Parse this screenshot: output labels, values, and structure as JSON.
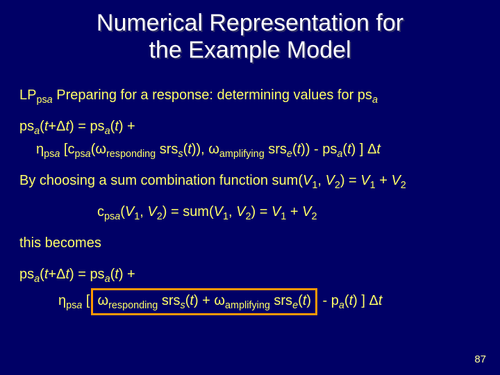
{
  "title_line1": "Numerical Representation for",
  "title_line2": "the Example Model",
  "lp_prefix": "LP",
  "lp_sub": "ps",
  "lp_sub_ital": "a",
  "lp_rest": " Preparing for a response: determining values for ps",
  "lp_tail_ital": "a",
  "eq1_lhs_ps": "ps",
  "eq1_lhs_a": "a",
  "eq1_lhs_paren": "(",
  "eq1_lhs_t": "t",
  "eq1_lhs_plus_dt": "+Δ",
  "eq1_lhs_t2": "t",
  "eq1_lhs_close_eq": ")  = ps",
  "eq1_rhs_a": "a",
  "eq1_rhs_paren": "(",
  "eq1_rhs_t": "t",
  "eq1_rhs_close_plus": ") +",
  "eq1b_eta": "η",
  "eq1b_eta_sub": "ps",
  "eq1b_eta_sub_a": "a",
  "eq1b_open": " [c",
  "eq1b_c_sub": "ps",
  "eq1b_c_sub_a": "a",
  "eq1b_w1": "(ω",
  "eq1b_w1_sub": "responding",
  "eq1b_srs_s": " srs",
  "eq1b_srs_s_sub": "s",
  "eq1b_srs_s_paren": "(",
  "eq1b_srs_s_t": "t",
  "eq1b_srs_s_close": ")), ω",
  "eq1b_w2_sub": "amplifying",
  "eq1b_srs_e": " srs",
  "eq1b_srs_e_sub": "e",
  "eq1b_srs_e_paren": "(",
  "eq1b_srs_e_t": "t",
  "eq1b_srs_e_close": ")) - ps",
  "eq1b_ps_a": "a",
  "eq1b_ps_paren": "(",
  "eq1b_ps_t": "t",
  "eq1b_tail": ") ] Δ",
  "eq1b_tail_t": "t",
  "sum_intro_a": "By choosing a sum combination function sum(",
  "sum_intro_v1": "V",
  "sum_intro_1": "1",
  "sum_intro_c": ", ",
  "sum_intro_v2": "V",
  "sum_intro_2": "2",
  "sum_intro_b": ") = ",
  "sum_intro_v1b": "V",
  "sum_intro_1b": "1",
  "sum_intro_p": " + ",
  "sum_intro_v2b": "V",
  "sum_intro_2b": "2",
  "eq2_c": "c",
  "eq2_c_sub": "ps",
  "eq2_c_sub_a": "a",
  "eq2_open": "(",
  "eq2_v1": "V",
  "eq2_1": "1",
  "eq2_c1": ", ",
  "eq2_v2": "V",
  "eq2_2": "2",
  "eq2_mid": ")  =  sum(",
  "eq2_v1b": "V",
  "eq2_1b": "1",
  "eq2_c2": ", ",
  "eq2_v2b": "V",
  "eq2_2b": "2",
  "eq2_eq2": ") = ",
  "eq2_v1c": "V",
  "eq2_1c": "1",
  "eq2_p2": " + ",
  "eq2_v2c": "V",
  "eq2_2c": "2",
  "becomes": "this becomes",
  "eq3_lhs_ps": "ps",
  "eq3_lhs_a": "a",
  "eq3_lhs_paren": "(",
  "eq3_lhs_t": "t",
  "eq3_lhs_plus_dt": "+Δ",
  "eq3_lhs_t2": "t",
  "eq3_lhs_close_eq": ")  = ps",
  "eq3_rhs_a": "a",
  "eq3_rhs_paren": "(",
  "eq3_rhs_t": "t",
  "eq3_rhs_close_plus": ") +",
  "eq3b_eta": "η",
  "eq3b_eta_sub": "ps",
  "eq3b_eta_sub_a": "a",
  "eq3b_outer_open": " [",
  "eq3b_w1": "ω",
  "eq3b_w1_sub": "responding",
  "eq3b_srs_s": " srs",
  "eq3b_srs_s_sub": "s",
  "eq3b_srs_s_paren": "(",
  "eq3b_srs_s_t": "t",
  "eq3b_srs_s_close": ") + ω",
  "eq3b_w2_sub": "amplifying",
  "eq3b_srs_e": " srs",
  "eq3b_srs_e_sub": "e",
  "eq3b_srs_e_paren": "(",
  "eq3b_srs_e_t": "t",
  "eq3b_srs_e_close": ")",
  "eq3b_minus_p": " - p",
  "eq3b_p_a": "a",
  "eq3b_p_paren": "(",
  "eq3b_p_t": "t",
  "eq3b_tail": ") ] Δ",
  "eq3b_tail_t": "t",
  "pagenum": "87"
}
